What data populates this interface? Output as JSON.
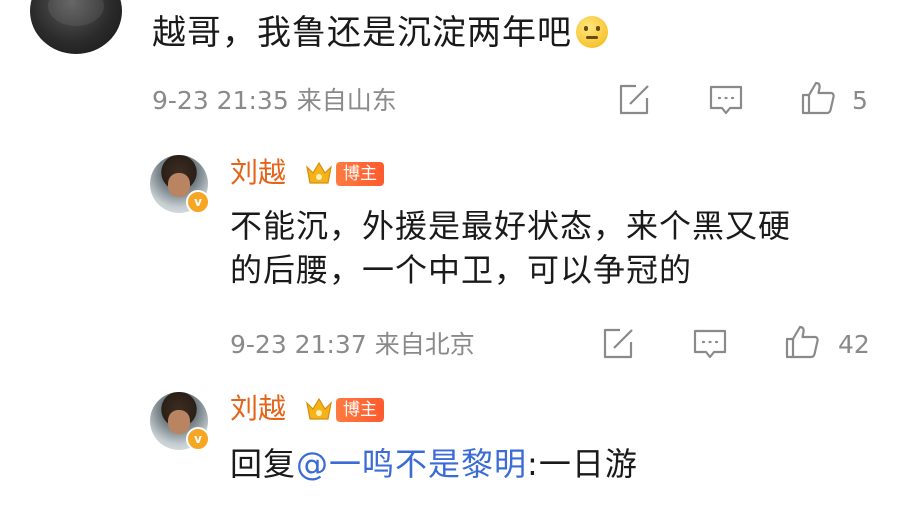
{
  "top_comment": {
    "text": "越哥，我鲁还是沉淀两年吧",
    "emoji": "thinking-face",
    "time": "9-23 21:35",
    "location": "来自山东",
    "like_count": "5"
  },
  "replies": [
    {
      "username": "刘越",
      "badge": "博主",
      "text_line1": "不能沉，外援是最好状态，来个黑又硬",
      "text_line2": "的后腰，一个中卫，可以争冠的",
      "time": "9-23 21:37",
      "location": "来自北京",
      "like_count": "42"
    },
    {
      "username": "刘越",
      "badge": "博主",
      "reply_prefix": "回复",
      "mention": "@一鸣不是黎明",
      "text": ":一日游"
    }
  ],
  "colors": {
    "username": "#e5641b",
    "badge": "#ff6a35",
    "mention": "#3b6bd6",
    "meta": "#8a8a8a",
    "icon": "#8a8a8a"
  }
}
